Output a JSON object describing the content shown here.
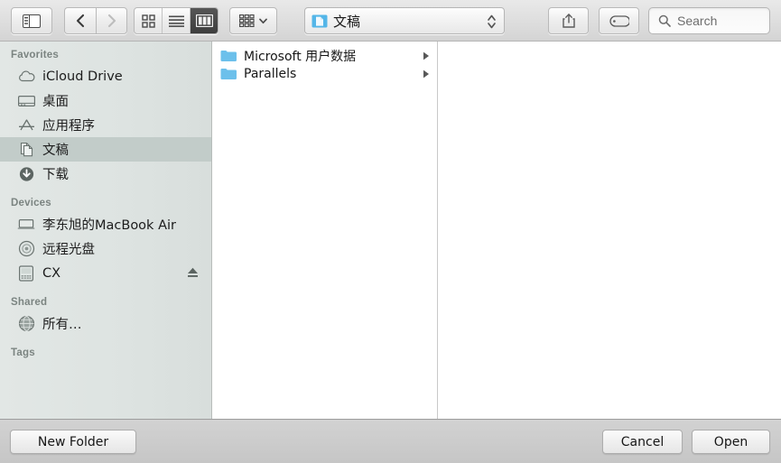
{
  "toolbar": {
    "sidebar_toggle": {
      "icon": "sidebar-toggle-icon",
      "title": "Toggle Sidebar"
    },
    "back": {
      "icon": "chevron-left-icon",
      "enabled": true
    },
    "forward": {
      "icon": "chevron-right-icon",
      "enabled": false
    },
    "view_modes": [
      {
        "id": "icon-view",
        "icon": "grid-icon",
        "active": false
      },
      {
        "id": "list-view",
        "icon": "list-icon",
        "active": false
      },
      {
        "id": "column-view",
        "icon": "columns-icon",
        "active": true
      }
    ],
    "arrange": {
      "icon": "arrange-grid-icon",
      "chevron": "chevron-down-icon"
    },
    "path_popup": {
      "icon": "documents-folder-icon",
      "label": "文稿",
      "stepper": "up-down-stepper-icon"
    },
    "share": {
      "icon": "share-icon"
    },
    "tag": {
      "icon": "tag-icon"
    },
    "search": {
      "icon": "search-icon",
      "placeholder": "Search",
      "value": ""
    }
  },
  "sidebar": {
    "sections": [
      {
        "header": "Favorites",
        "items": [
          {
            "label": "iCloud Drive",
            "icon": "cloud-icon",
            "selected": false
          },
          {
            "label": "桌面",
            "icon": "desktop-icon",
            "selected": false
          },
          {
            "label": "应用程序",
            "icon": "applications-icon",
            "selected": false
          },
          {
            "label": "文稿",
            "icon": "documents-icon",
            "selected": true
          },
          {
            "label": "下载",
            "icon": "downloads-icon",
            "selected": false
          }
        ]
      },
      {
        "header": "Devices",
        "items": [
          {
            "label": "李东旭的MacBook Air",
            "icon": "laptop-icon",
            "selected": false
          },
          {
            "label": "远程光盘",
            "icon": "disc-icon",
            "selected": false
          },
          {
            "label": "CX",
            "icon": "harddrive-icon",
            "selected": false,
            "eject": true
          }
        ]
      },
      {
        "header": "Shared",
        "items": [
          {
            "label": "所有…",
            "icon": "globe-icon",
            "selected": false
          }
        ]
      },
      {
        "header": "Tags",
        "items": []
      }
    ]
  },
  "columns": [
    {
      "name": "documents-column",
      "files": [
        {
          "name": "Microsoft 用户数据",
          "icon": "folder-icon",
          "has_children": true
        },
        {
          "name": "Parallels",
          "icon": "folder-icon",
          "has_children": true
        }
      ]
    },
    {
      "name": "preview-column",
      "files": []
    }
  ],
  "footer": {
    "new_folder": "New Folder",
    "cancel": "Cancel",
    "open": "Open"
  },
  "colors": {
    "folder_blue": "#6cc0eb",
    "sidebar_bg": "#dde3e1",
    "sidebar_selection": "#c2ccc9",
    "toolbar_bg": "#dddddd",
    "footer_bg": "#cbcbcb",
    "active_segment": "#484848"
  }
}
